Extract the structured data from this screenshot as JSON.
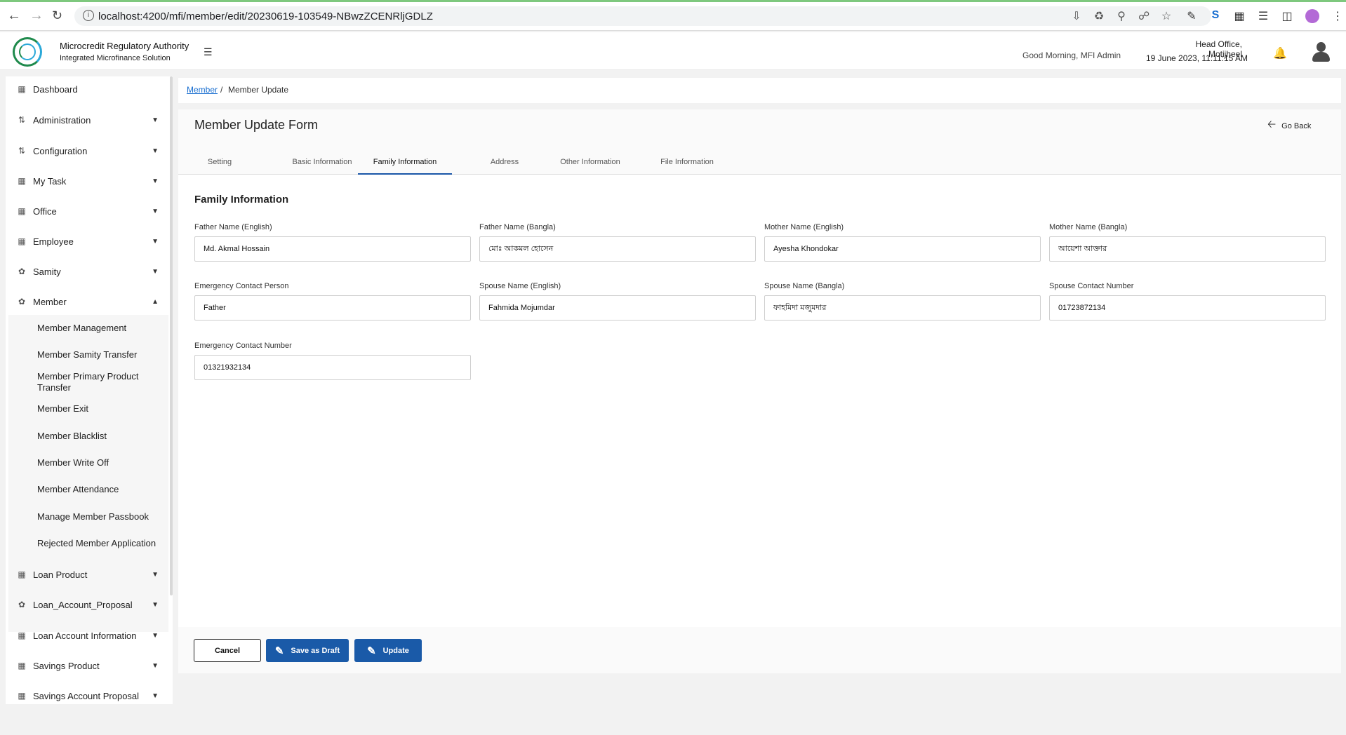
{
  "browser": {
    "url": "localhost:4200/mfi/member/edit/20230619-103549-NBwzZCENRljGDLZ"
  },
  "header": {
    "org_name": "Microcredit Regulatory Authority",
    "org_sub": "Integrated Microfinance Solution",
    "greeting": "Good Morning, MFI Admin",
    "office": "Head Office, Motijheel",
    "datetime": "19 June 2023, 11:11:15 AM"
  },
  "sidebar": {
    "items": [
      {
        "label": "Dashboard",
        "icon": "dashboard-icon"
      },
      {
        "label": "Administration",
        "icon": "sliders-icon"
      },
      {
        "label": "Configuration",
        "icon": "sliders-icon"
      },
      {
        "label": "My Task",
        "icon": "task-icon"
      },
      {
        "label": "Office",
        "icon": "office-icon"
      },
      {
        "label": "Employee",
        "icon": "employee-icon"
      },
      {
        "label": "Samity",
        "icon": "group-icon"
      },
      {
        "label": "Member",
        "icon": "member-icon"
      },
      {
        "label": "Loan Product",
        "icon": "product-icon"
      },
      {
        "label": "Loan_Account_Proposal",
        "icon": "group-icon"
      },
      {
        "label": "Loan Account Information",
        "icon": "account-icon"
      },
      {
        "label": "Savings Product",
        "icon": "product-icon"
      },
      {
        "label": "Savings Account Proposal",
        "icon": "account-icon"
      }
    ],
    "member_sub": [
      "Member Management",
      "Member Samity Transfer",
      "Member Primary Product Transfer",
      "Member Exit",
      "Member Blacklist",
      "Member Write Off",
      "Member Attendance",
      "Manage Member Passbook",
      "Rejected Member Application"
    ]
  },
  "breadcrumb": {
    "link": "Member",
    "sep": "/",
    "current": "Member Update"
  },
  "form": {
    "title": "Member Update Form",
    "go_back": "Go Back",
    "tabs": [
      "Setting",
      "Basic Information",
      "Family Information",
      "Address",
      "Other Information",
      "File Information"
    ],
    "active_tab": "Family Information",
    "section_title": "Family Information",
    "fields": [
      {
        "label": "Father Name (English)",
        "value": "Md. Akmal Hossain"
      },
      {
        "label": "Father Name (Bangla)",
        "value": "মোঃ আকমল হোসেন"
      },
      {
        "label": "Mother Name (English)",
        "value": "Ayesha Khondokar"
      },
      {
        "label": "Mother Name (Bangla)",
        "value": "আয়েশা আক্তার"
      },
      {
        "label": "Emergency Contact Person",
        "value": "Father"
      },
      {
        "label": "Spouse Name (English)",
        "value": "Fahmida Mojumdar"
      },
      {
        "label": "Spouse Name (Bangla)",
        "value": "ফাহমিদা মজুমদার"
      },
      {
        "label": "Spouse Contact Number",
        "value": "01723872134"
      },
      {
        "label": "Emergency Contact Number",
        "value": "01321932134"
      }
    ],
    "buttons": {
      "cancel": "Cancel",
      "draft": "Save as Draft",
      "update": "Update"
    }
  },
  "colors": {
    "primary": "#1a5aa8",
    "link": "#1a6fd0",
    "logo_green": "#1f8a4c",
    "logo_blue": "#2aa8d8"
  }
}
